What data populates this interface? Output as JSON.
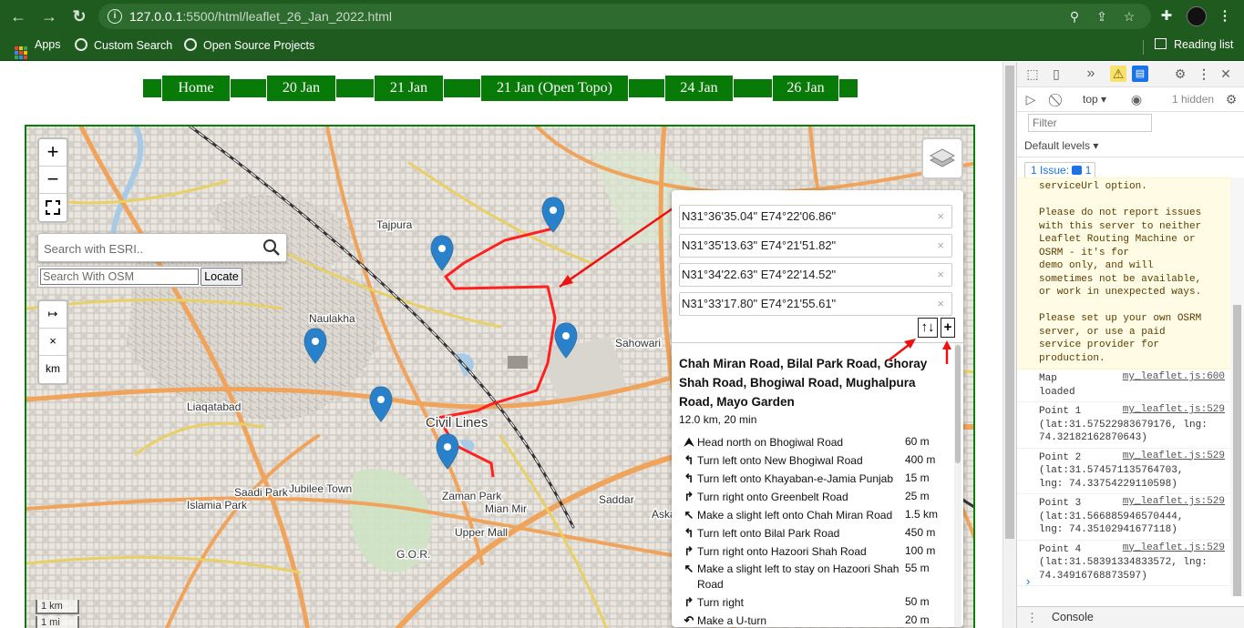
{
  "browser": {
    "url_host": "127.0.0.1",
    "url_rest": ":5500/html/leaflet_26_Jan_2022.html",
    "bookmarks": [
      "Apps",
      "Custom Search",
      "Open Source Projects"
    ],
    "reading_list": "Reading list"
  },
  "menu": {
    "items": [
      "Home",
      "20 Jan",
      "21 Jan",
      "21 Jan (Open Topo)",
      "24 Jan",
      "26 Jan"
    ]
  },
  "map": {
    "zoom_in": "+",
    "zoom_out": "−",
    "esri_placeholder": "Search with ESRI..",
    "osm_placeholder": "Search With OSM",
    "locate_label": "Locate",
    "measure_buttons": [
      "↦",
      "×",
      "km"
    ],
    "scale": [
      "1 km",
      "1 mi"
    ],
    "labels": {
      "naulakha": "Naulakha",
      "sahowari": "Sahowari",
      "civil_lines": "Civil Lines",
      "zaman_park": "Zaman Park",
      "mian_mir": "Mian Mir",
      "saddar": "Saddar",
      "liaqatabad": "Liaqatabad",
      "islamia_park": "Islamia Park",
      "saadi_park": "Saadi Park",
      "jubilee_town": "Jubilee Town",
      "gor": "G.O.R.",
      "upper_mall": "Upper Mall",
      "askari": "Aska",
      "tajpura": "Tajpura"
    }
  },
  "routing": {
    "waypoints": [
      "N31°36'35.04\" E74°22'06.86\"",
      "N31°35'13.63\" E74°21'51.82\"",
      "N31°34'22.63\" E74°22'14.52\"",
      "N31°33'17.80\" E74°21'55.61\""
    ],
    "remove_glyph": "×",
    "reverse_label": "↑↓",
    "add_label": "+",
    "route_title": "Chah Miran Road, Bilal Park Road, Ghoray Shah Road, Bhogiwal Road, Mughalpura Road, Mayo Garden",
    "summary": "12.0 km, 20 min",
    "instructions": [
      {
        "icon": "⮝",
        "text": "Head north on Bhogiwal Road",
        "distance": "60 m"
      },
      {
        "icon": "↰",
        "text": "Turn left onto New Bhogiwal Road",
        "distance": "400 m"
      },
      {
        "icon": "↰",
        "text": "Turn left onto Khayaban-e-Jamia Punjab",
        "distance": "15 m"
      },
      {
        "icon": "↱",
        "text": "Turn right onto Greenbelt Road",
        "distance": "25 m"
      },
      {
        "icon": "↖",
        "text": "Make a slight left onto Chah Miran Road",
        "distance": "1.5 km"
      },
      {
        "icon": "↰",
        "text": "Turn left onto Bilal Park Road",
        "distance": "450 m"
      },
      {
        "icon": "↱",
        "text": "Turn right onto Hazoori Shah Road",
        "distance": "100 m"
      },
      {
        "icon": "↖",
        "text": "Make a slight left to stay on Hazoori Shah Road",
        "distance": "55 m"
      },
      {
        "icon": "↱",
        "text": "Turn right",
        "distance": "50 m"
      },
      {
        "icon": "↶",
        "text": "Make a U-turn",
        "distance": "20 m"
      }
    ]
  },
  "devtools": {
    "context": "top",
    "hidden_count": "1 hidden",
    "filter_placeholder": "Filter",
    "levels": "Default levels",
    "issues": "1 Issue:",
    "issues_count": "1",
    "warning_text": "serviceUrl option.\n\nPlease do not report issues\nwith this server to neither\nLeaflet Routing Machine or\nOSRM - it's for\ndemo only, and will\nsometimes not be available,\nor work in unexpected ways.\n\nPlease set up your own OSRM\nserver, or use a paid\nservice provider for\nproduction.",
    "logs": [
      {
        "text": "Map\nloaded",
        "source": "my_leaflet.js:600"
      },
      {
        "text": "Point 1\n(lat:31.57522983679176, lng:\n74.32182162870643)",
        "source": "my_leaflet.js:529"
      },
      {
        "text": "Point 2\n(lat:31.574571135764703,\nlng: 74.33754229110598)",
        "source": "my_leaflet.js:529"
      },
      {
        "text": "Point 3\n(lat:31.566885946570444,\nlng: 74.35102941677118)",
        "source": "my_leaflet.js:529"
      },
      {
        "text": "Point 4\n(lat:31.58391334833572, lng:\n74.34916768873597)",
        "source": "my_leaflet.js:529"
      }
    ],
    "prompt": "›",
    "drawer_tab": "Console"
  }
}
